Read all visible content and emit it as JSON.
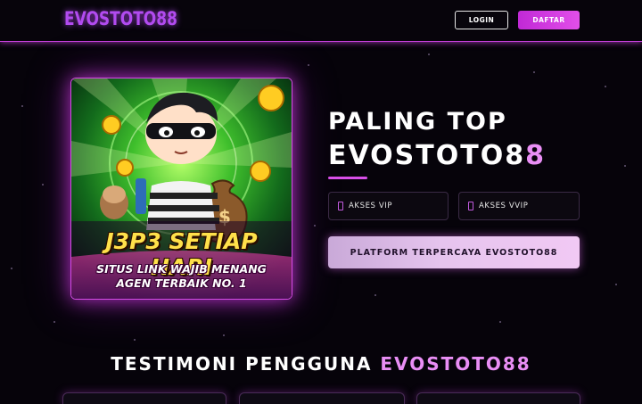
{
  "header": {
    "logo": "EVOSTOTO88",
    "login_label": "LOGIN",
    "daftar_label": "DAFTAR"
  },
  "banner": {
    "title": "J3P3 SETIAP HARI",
    "line1": "SITUS LINK WAJIB MENANG",
    "line2": "AGEN TERBAIK NO. 1"
  },
  "hero": {
    "headline1": "PALING TOP",
    "headline2_main": "EVOSTOTO8",
    "headline2_tail": "8",
    "vip_label": "AKSES VIP",
    "vvip_label": "AKSES VVIP",
    "platform_label": "PLATFORM TERPERCAYA EVOSTOTO88"
  },
  "testimoni": {
    "prefix": "TESTIMONI PENGGUNA",
    "brand": "EVOSTOTO88"
  },
  "colors": {
    "accent": "#d64be6",
    "accent_light": "#e98ef5",
    "background": "#06030a",
    "banner_title": "#ffe14a"
  }
}
